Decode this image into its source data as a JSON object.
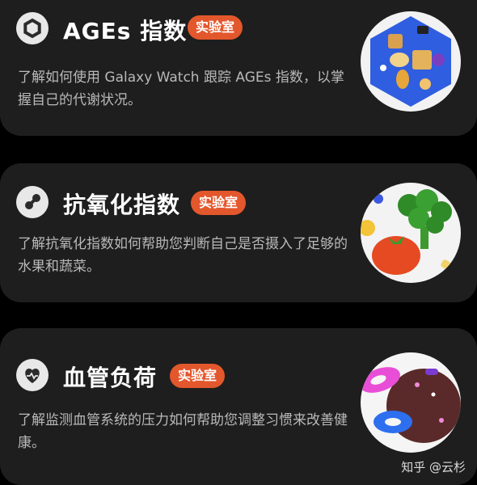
{
  "cards": [
    {
      "title": "AGEs 指数",
      "badge": "实验室",
      "desc": "了解如何使用 Galaxy Watch 跟踪 AGEs 指数，以掌握自己的代谢状况。",
      "icon": "hexagon-icon"
    },
    {
      "title": "抗氧化指数",
      "badge": "实验室",
      "desc": "了解抗氧化指数如何帮助您判断自己是否摄入了足够的水果和蔬菜。",
      "icon": "antioxidant-icon"
    },
    {
      "title": "血管负荷",
      "badge": "实验室",
      "desc": "了解监测血管系统的压力如何帮助您调整习惯来改善健康。",
      "icon": "heart-icon"
    }
  ],
  "watermark": "知乎 @云杉",
  "colors": {
    "badge": "#e3572c",
    "card": "#1e1e1e",
    "background": "#000000"
  }
}
